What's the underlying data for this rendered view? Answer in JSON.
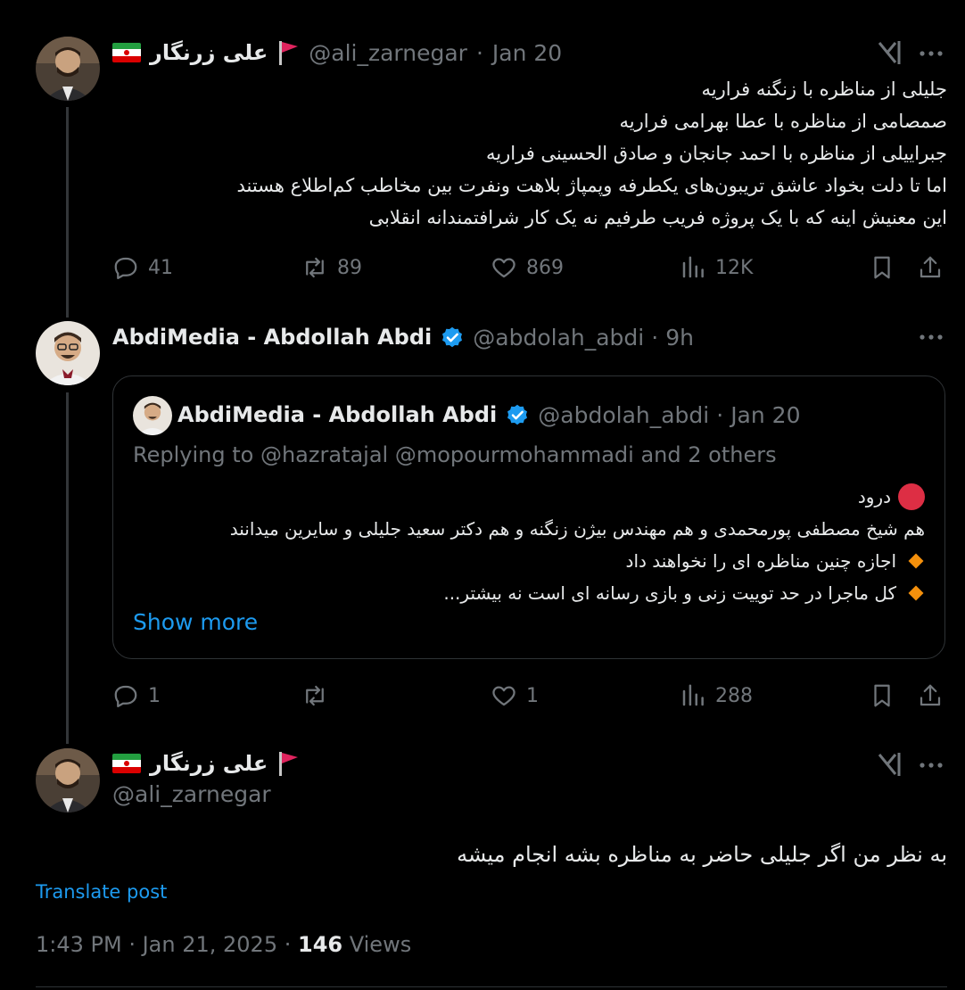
{
  "tweet1": {
    "display_name": "علی زرنگار",
    "handle": "@ali_zarnegar",
    "time": "Jan 20",
    "lines": [
      "جلیلی از مناظره با زنگنه فراریه",
      "صمصامی از مناظره با عطا بهرامی فراریه",
      "جبراییلی از مناظره با احمد جانجان و صادق الحسینی فراریه",
      "اما تا دلت بخواد عاشق تریبون‌های یکطرفه وپمپاژ بلاهت ونفرت بین مخاطب کم‌اطلاع هستند",
      "این معنیش اینه که با یک پروژه فریب طرفیم نه یک کار شرافتمندانه انقلابی"
    ],
    "replies": "41",
    "reposts": "89",
    "likes": "869",
    "views": "12K"
  },
  "tweet2": {
    "display_name": "AbdiMedia - Abdollah Abdi",
    "handle": "@abdolah_abdi",
    "time": "9h",
    "replies": "1",
    "likes": "1",
    "views": "288",
    "quote": {
      "display_name": "AbdiMedia - Abdollah Abdi",
      "handle": "@abdolah_abdi",
      "time": "Jan 20",
      "replying_prefix": "Replying to",
      "replying_mentions": "@hazratajal @mopourmohammadi",
      "replying_suffix": "and 2 others",
      "lines": [
        "درود",
        "هم شیخ مصطفی پورمحمدی و  هم مهندس بیژن زنگنه و  هم دکتر سعید جلیلی و سایرین میدانند",
        "اجازه چنین مناظره ای را نخواهند داد",
        "کل ماجرا در حد توییت زنی و بازی رسانه ای است نه بیشتر..."
      ],
      "show_more": "Show more"
    }
  },
  "tweet3": {
    "display_name": "علی زرنگار",
    "handle": "@ali_zarnegar",
    "text": "به نظر من اگر جلیلی حاضر به مناظره بشه انجام میشه",
    "translate": "Translate post",
    "timestamp": "1:43 PM · Jan 21, 2025",
    "views_count": "146",
    "views_label": "Views"
  },
  "colors": {
    "background": "#000000",
    "text": "#e7e9ea",
    "muted": "#71767b",
    "link": "#1d9bf0",
    "border": "#2f3336"
  }
}
